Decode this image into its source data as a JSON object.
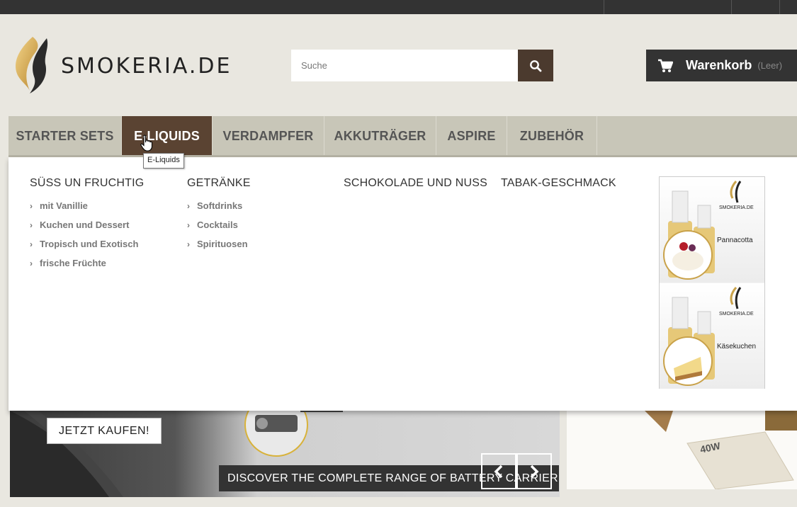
{
  "brand": {
    "name": "SMOKERIA.DE"
  },
  "search": {
    "placeholder": "Suche"
  },
  "cart": {
    "label": "Warenkorb",
    "status": "(Leer)"
  },
  "nav": {
    "items": [
      {
        "label": "STARTER SETS"
      },
      {
        "label": "E-LIQUIDS"
      },
      {
        "label": "VERDAMPFER"
      },
      {
        "label": "AKKUTRÄGER"
      },
      {
        "label": "ASPIRE"
      },
      {
        "label": "ZUBEHÖR"
      }
    ],
    "active": "E-LIQUIDS",
    "tooltip": "E-Liquids"
  },
  "menu": {
    "columns": [
      {
        "title": "SÜSS UN FRUCHTIG",
        "links": [
          "mit Vanillie",
          "Kuchen und Dessert",
          "Tropisch und Exotisch",
          "frische Früchte"
        ]
      },
      {
        "title": "GETRÄNKE",
        "links": [
          "Softdrinks",
          "Cocktails",
          "Spirituosen"
        ]
      },
      {
        "title": "SCHOKOLADE UND NUSS",
        "links": []
      },
      {
        "title": "TABAK-GESCHMACK",
        "links": []
      }
    ],
    "promos": [
      {
        "brand": "SMOKERIA.DE",
        "label": "Pannacotta"
      },
      {
        "brand": "SMOKERIA.DE",
        "label": "Käsekuchen"
      }
    ]
  },
  "hero": {
    "cta": "JETZT KAUFEN!",
    "caption": "DISCOVER THE COMPLETE RANGE OF BATTERY CARRIER",
    "side_text": "40W"
  },
  "colors": {
    "accent": "#5a4332",
    "topbar": "#333333",
    "nav": "#c8c6b8"
  }
}
